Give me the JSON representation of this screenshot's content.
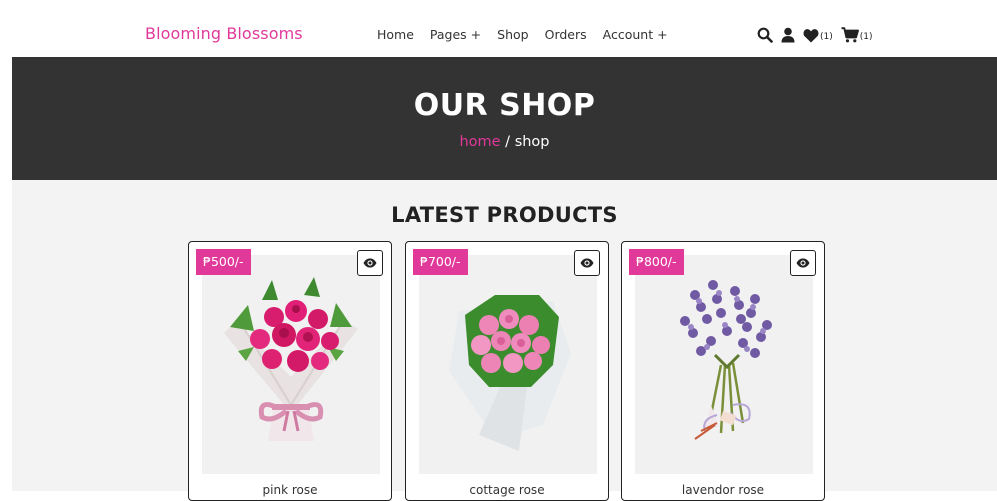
{
  "header": {
    "brand": "Blooming Blossoms",
    "nav": [
      "Home",
      "Pages +",
      "Shop",
      "Orders",
      "Account +"
    ],
    "wishlist_count": "(1)",
    "cart_count": "(1)",
    "icons": [
      "search-icon",
      "user-icon",
      "heart-icon",
      "cart-icon"
    ]
  },
  "hero": {
    "title": "OUR SHOP",
    "breadcrumb_home": "home",
    "breadcrumb_sep": " / ",
    "breadcrumb_current": "shop"
  },
  "products": {
    "title": "LATEST PRODUCTS",
    "items": [
      {
        "price": "₱500/-",
        "name": "pink rose"
      },
      {
        "price": "₱700/-",
        "name": "cottage rose"
      },
      {
        "price": "₱800/-",
        "name": "lavendor rose"
      }
    ]
  },
  "colors": {
    "accent": "#e0399a",
    "hero_bg": "#333333",
    "section_bg": "#f3f3f3"
  }
}
